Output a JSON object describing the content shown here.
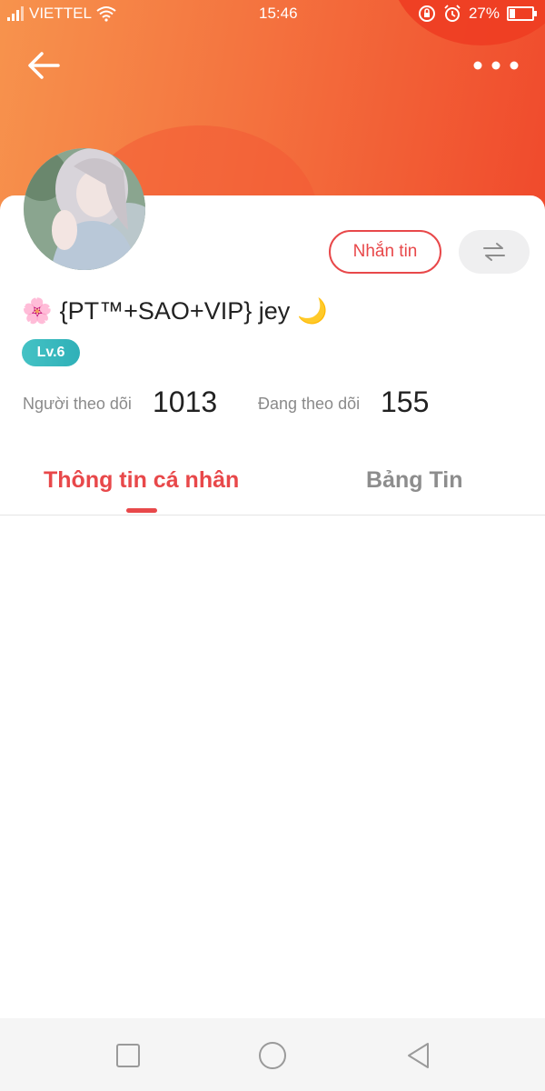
{
  "status_bar": {
    "carrier": "VIETTEL",
    "time": "15:46",
    "battery_percent": "27%",
    "battery_level": 0.27,
    "icons": [
      "signal-icon",
      "wifi-icon",
      "rotation-lock-icon",
      "alarm-icon",
      "battery-icon"
    ]
  },
  "header": {
    "back_icon": "arrow-left-icon",
    "more_icon": "more-horizontal-icon",
    "colors": {
      "gradient_start": "#f7934d",
      "gradient_end": "#f04a2c"
    }
  },
  "profile": {
    "avatar_icon": "avatar-image",
    "name_prefix_emoji": "🌸",
    "name": "{PT™+SAO+VIP} jey",
    "name_suffix_emoji": "🌙",
    "level": "Lv.6",
    "message_button": "Nhắn tin",
    "swap_icon": "swap-arrows-icon",
    "followers_label": "Người theo dõi",
    "followers_count": "1013",
    "following_label": "Đang theo dõi",
    "following_count": "155",
    "accent_color": "#e8484a",
    "level_color": "#3bb9bf"
  },
  "tabs": [
    {
      "label": "Thông tin cá nhân",
      "active": true
    },
    {
      "label": "Bảng Tin",
      "active": false
    }
  ],
  "nav_bar": {
    "icons": [
      "recent-apps-icon",
      "home-icon",
      "back-triangle-icon"
    ]
  }
}
